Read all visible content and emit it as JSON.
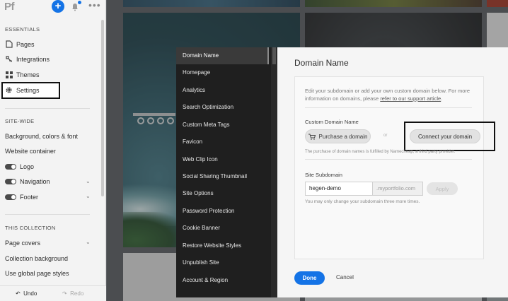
{
  "app": {
    "logo": "Pf"
  },
  "header": {
    "add_icon": "plus-icon",
    "notification_icon": "bell-icon",
    "more_icon": "more-icon"
  },
  "sidebar": {
    "essentials_title": "ESSENTIALS",
    "essentials": [
      {
        "label": "Pages",
        "icon": "pages-icon"
      },
      {
        "label": "Integrations",
        "icon": "integrations-icon"
      },
      {
        "label": "Themes",
        "icon": "themes-icon"
      },
      {
        "label": "Settings",
        "icon": "gear-icon"
      }
    ],
    "sitewide_title": "SITE-WIDE",
    "sitewide_items": [
      "Background, colors & font",
      "Website container"
    ],
    "toggles": [
      {
        "label": "Logo",
        "on": true,
        "expandable": false
      },
      {
        "label": "Navigation",
        "on": true,
        "expandable": true
      },
      {
        "label": "Footer",
        "on": true,
        "expandable": true
      }
    ],
    "collection_title": "THIS COLLECTION",
    "collection_items": [
      {
        "label": "Page covers",
        "expandable": true
      },
      {
        "label": "Collection background",
        "expandable": false
      },
      {
        "label": "Use global page styles",
        "expandable": false
      }
    ],
    "undo_label": "Undo",
    "redo_label": "Redo"
  },
  "settings_nav": {
    "items": [
      "Domain Name",
      "Homepage",
      "Analytics",
      "Search Optimization",
      "Custom Meta Tags",
      "Favicon",
      "Web Clip Icon",
      "Social Sharing Thumbnail",
      "Site Options",
      "Password Protection",
      "Cookie Banner",
      "Restore Website Styles",
      "Unpublish Site",
      "Account & Region"
    ],
    "active_index": 0
  },
  "domain": {
    "title": "Domain Name",
    "description": "Edit your subdomain or add your own custom domain below. For more information on domains, please ",
    "support_link": "refer to our support article",
    "description_end": ".",
    "custom_label": "Custom Domain Name",
    "purchase_label": "Purchase a domain",
    "or_label": "or",
    "connect_label": "Connect your domain",
    "purchase_note": "The purchase of domain names is fulfilled by Namecheap, a third party provider.",
    "subdomain_label": "Site Subdomain",
    "subdomain_value": "hegen-demo",
    "subdomain_suffix": ".myportfolio.com",
    "apply_label": "Apply",
    "change_note": "You may only change your subdomain three more times.",
    "done_label": "Done",
    "cancel_label": "Cancel"
  },
  "colors": {
    "accent": "#1473e6",
    "nav_bg": "#1f1f1f",
    "panel_bg": "#f3f3f3"
  }
}
